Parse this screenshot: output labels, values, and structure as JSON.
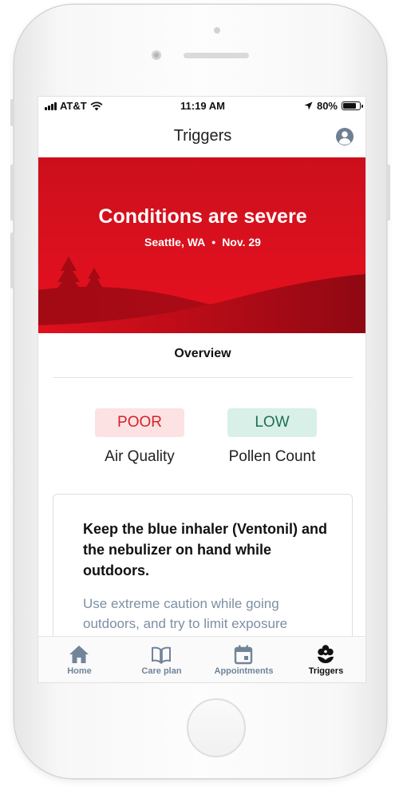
{
  "status_bar": {
    "carrier": "AT&T",
    "time": "11:19 AM",
    "battery": "80%",
    "battery_level": 0.8
  },
  "header": {
    "title": "Triggers",
    "profile_icon": "user-circle-icon"
  },
  "hero": {
    "title": "Conditions are severe",
    "location": "Seattle, WA",
    "separator": "•",
    "date": "Nov. 29",
    "color": "#e8111f"
  },
  "overview": {
    "title": "Overview"
  },
  "metrics": [
    {
      "value": "POOR",
      "label": "Air Quality",
      "color": "#d4232a"
    },
    {
      "value": "LOW",
      "label": "Pollen Count",
      "color": "#1f6e55"
    }
  ],
  "card": {
    "heading": "Keep the blue inhaler (Ventonil) and the nebulizer on hand while outdoors.",
    "body": "Use extreme caution while going outdoors, and try to limit exposure"
  },
  "tab_bar": {
    "items": [
      {
        "label": "Home",
        "icon": "home-icon",
        "active": false
      },
      {
        "label": "Care plan",
        "icon": "book-icon",
        "active": false
      },
      {
        "label": "Appointments",
        "icon": "calendar-icon",
        "active": false
      },
      {
        "label": "Triggers",
        "icon": "flower-icon",
        "active": true
      }
    ]
  }
}
